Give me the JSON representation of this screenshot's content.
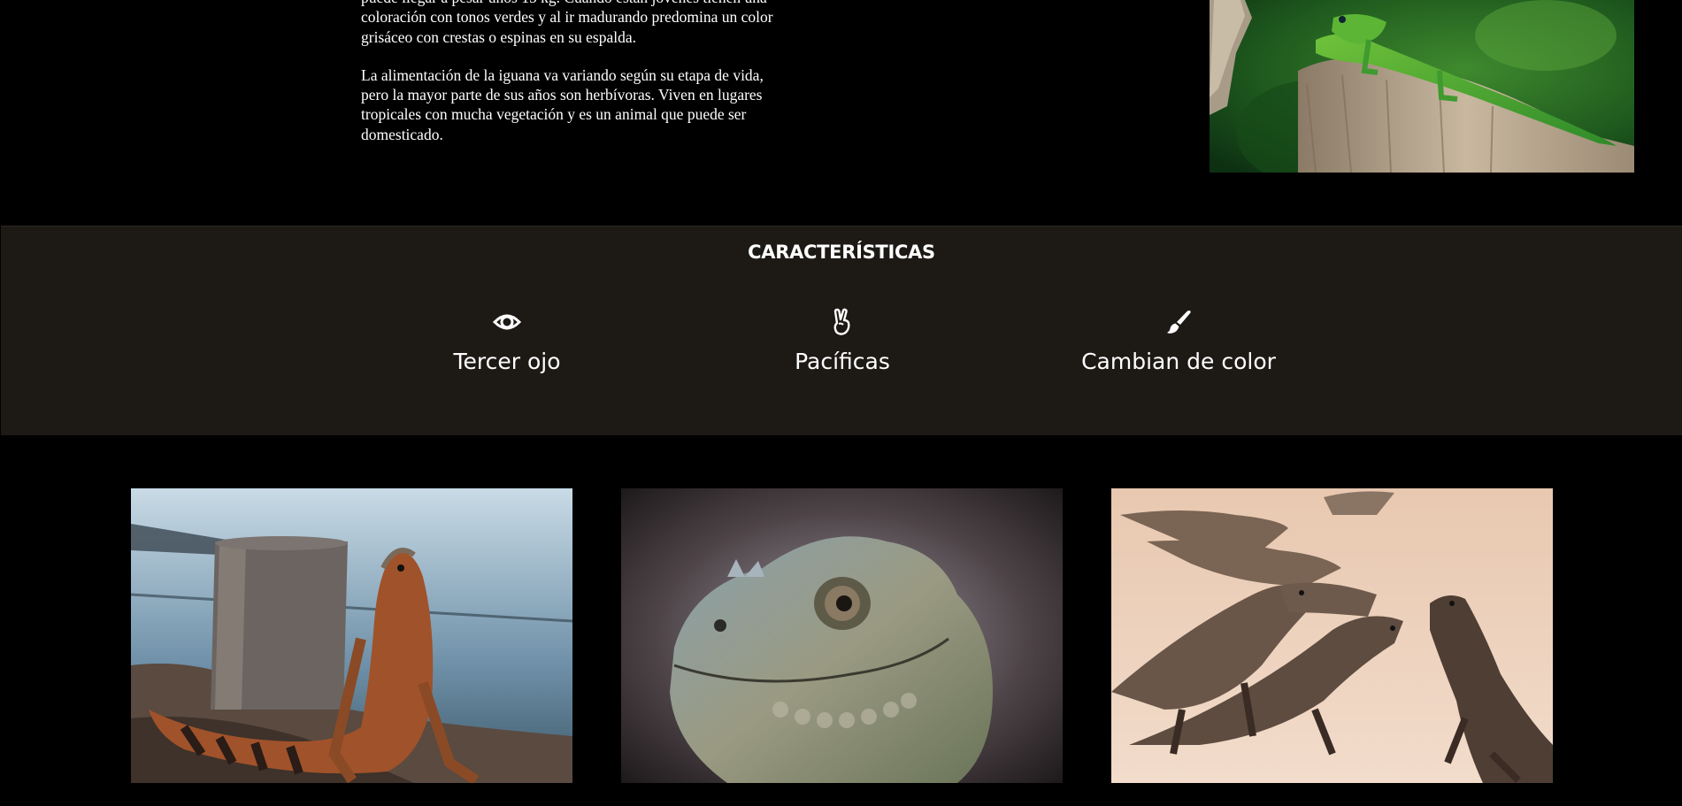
{
  "intro": {
    "paragraph1": "puede llegar a pesar unos 15 kg. Cuando están jóvenes tienen una coloración con tonos verdes y al ir madurando predomina un color grisáceo con crestas o espinas en su espalda.",
    "paragraph2": "La alimentación de la iguana va variando según su etapa de vida, pero la mayor parte de sus años son herbívoras. Viven en lugares tropicales con mucha vegetación y es un animal que puede ser domesticado."
  },
  "features": {
    "title": "CARACTERÍSTICAS",
    "items": [
      {
        "icon": "eye-icon",
        "label": "Tercer ojo"
      },
      {
        "icon": "peace-hand-icon",
        "label": "Pacíficas"
      },
      {
        "icon": "paint-brush-icon",
        "label": "Cambian de color"
      }
    ]
  },
  "colors": {
    "page_background": "#000000",
    "band_background": "#1d1a16",
    "text": "#ffffff"
  }
}
